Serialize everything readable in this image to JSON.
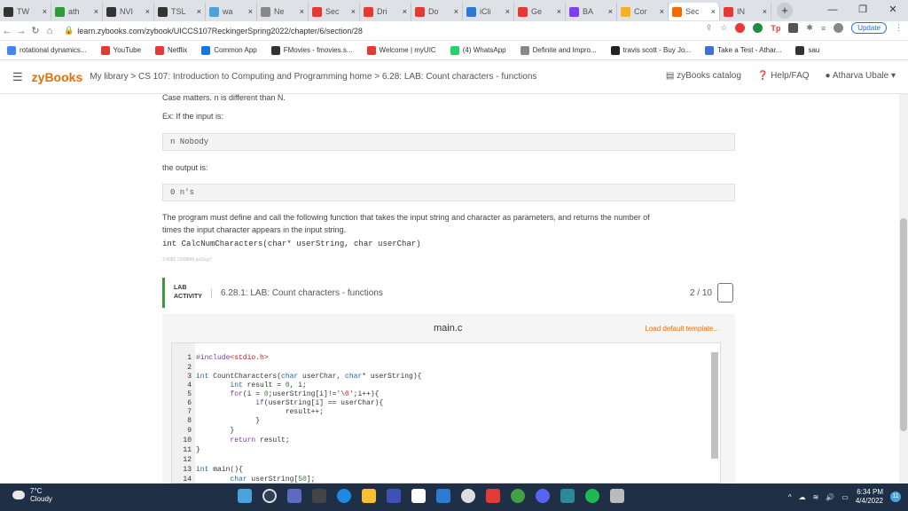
{
  "tabs": [
    {
      "label": "TW",
      "color": "#333"
    },
    {
      "label": "ath",
      "color": "#2e9c3a"
    },
    {
      "label": "NVI",
      "color": "#333"
    },
    {
      "label": "TSL",
      "color": "#333"
    },
    {
      "label": "wa",
      "color": "#4aa3df"
    },
    {
      "label": "Ne",
      "color": "#888"
    },
    {
      "label": "Sec",
      "color": "#e53935"
    },
    {
      "label": "Dri",
      "color": "#e53935"
    },
    {
      "label": "Do",
      "color": "#e53935"
    },
    {
      "label": "iCli",
      "color": "#2a7ad6"
    },
    {
      "label": "Ge",
      "color": "#e53935"
    },
    {
      "label": "BA",
      "color": "#7e3ff2"
    },
    {
      "label": "Cor",
      "color": "#f6b026"
    },
    {
      "label": "Sec",
      "color": "#ef6c00"
    },
    {
      "label": "IN",
      "color": "#e53935"
    }
  ],
  "browser": {
    "url": "learn.zybooks.com/zybook/UICCS107ReckingerSpring2022/chapter/6/section/28",
    "update_label": "Update"
  },
  "bookmarks": [
    {
      "label": "rotational dynamics...",
      "color": "#4285f4"
    },
    {
      "label": "YouTube",
      "color": "#e53935"
    },
    {
      "label": "Netflix",
      "color": "#e53935"
    },
    {
      "label": "Common App",
      "color": "#1a73e8"
    },
    {
      "label": "FMovies - fmovies.s...",
      "color": "#333"
    },
    {
      "label": "Welcome | myUIC",
      "color": "#e53935"
    },
    {
      "label": "(4) WhatsApp",
      "color": "#25d366"
    },
    {
      "label": "Definite and Impro...",
      "color": "#888"
    },
    {
      "label": "travis scott - Buy Jo...",
      "color": "#222"
    },
    {
      "label": "Take a Test - Athar...",
      "color": "#3f6fd8"
    },
    {
      "label": "sau",
      "color": "#333"
    }
  ],
  "zy": {
    "logo": "zyBooks",
    "breadcrumb": "My library > CS 107: Introduction to Computing and Programming home > 6.28: LAB: Count characters - functions",
    "catalog": "zyBooks catalog",
    "help": "Help/FAQ",
    "user": "Atharva Ubale"
  },
  "content": {
    "case_text": "Case matters. n is different than N.",
    "example_intro": "Ex: If the input is:",
    "example_input": "n Nobody",
    "output_intro": "the output is:",
    "example_output": "0 n's",
    "desc_line1": "The program must define and call the following function that takes the input string and character as parameters, and returns the number of",
    "desc_line2": "times the input character appears in the input string.",
    "signature": "int CalcNumCharacters(char* userString, char userChar)",
    "hash_id": "3:4082.1599846.qx3zqy7"
  },
  "lab": {
    "tag_line1": "LAB",
    "tag_line2": "ACTIVITY",
    "title": "6.28.1: LAB: Count characters - functions",
    "score": "2 / 10"
  },
  "editor": {
    "filename": "main.c",
    "load_default": "Load default template..."
  },
  "taskbar": {
    "temp": "7°C",
    "weather": "Cloudy",
    "time": "6:34 PM",
    "date": "4/4/2022",
    "notif_count": "11"
  }
}
